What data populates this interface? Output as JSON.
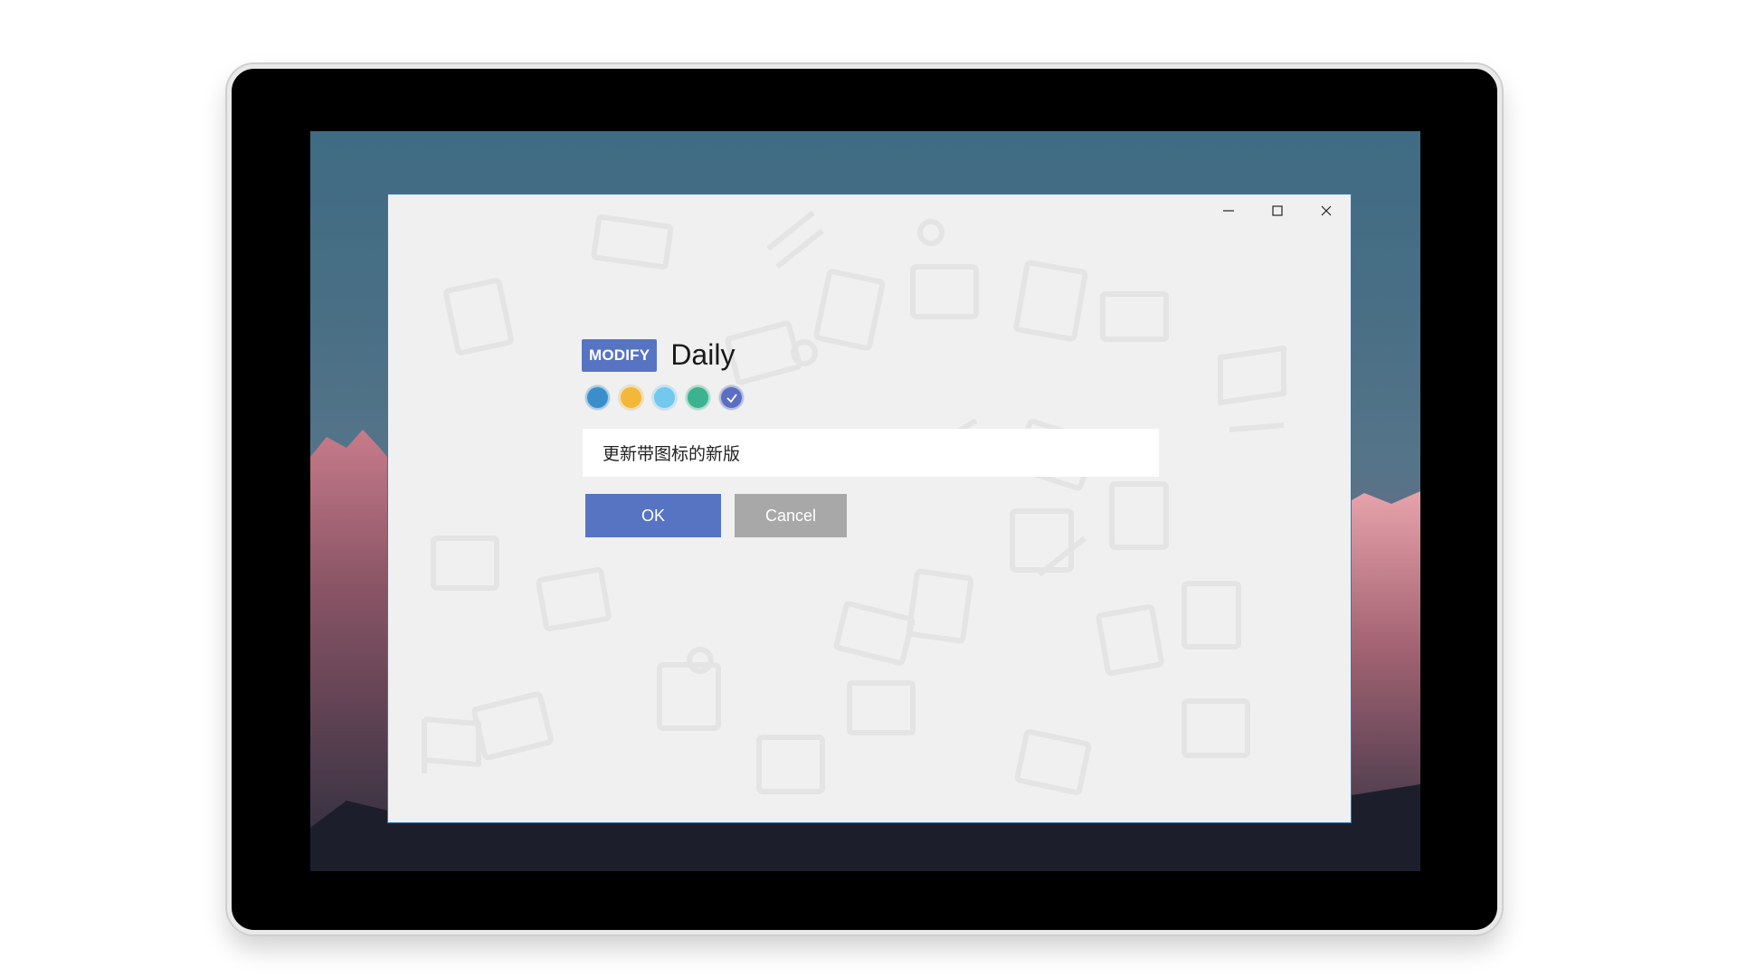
{
  "dialog": {
    "badge_label": "MODIFY",
    "title": "Daily",
    "input_value": "更新带图标的新版",
    "ok_label": "OK",
    "cancel_label": "Cancel"
  },
  "color_options": [
    {
      "name": "blue",
      "hex": "#3a8fcb",
      "selected": false
    },
    {
      "name": "yellow",
      "hex": "#f3b73a",
      "selected": false
    },
    {
      "name": "light-blue",
      "hex": "#72c8ee",
      "selected": false
    },
    {
      "name": "green",
      "hex": "#3bb390",
      "selected": false
    },
    {
      "name": "indigo",
      "hex": "#5a6fc1",
      "selected": true
    }
  ],
  "window_controls": [
    "minimize-icon",
    "maximize-icon",
    "close-icon"
  ],
  "colors": {
    "accent": "#5774c3",
    "cancel": "#a8a8a8",
    "window_border": "#2a78c6",
    "window_bg": "#f0f0f0"
  }
}
